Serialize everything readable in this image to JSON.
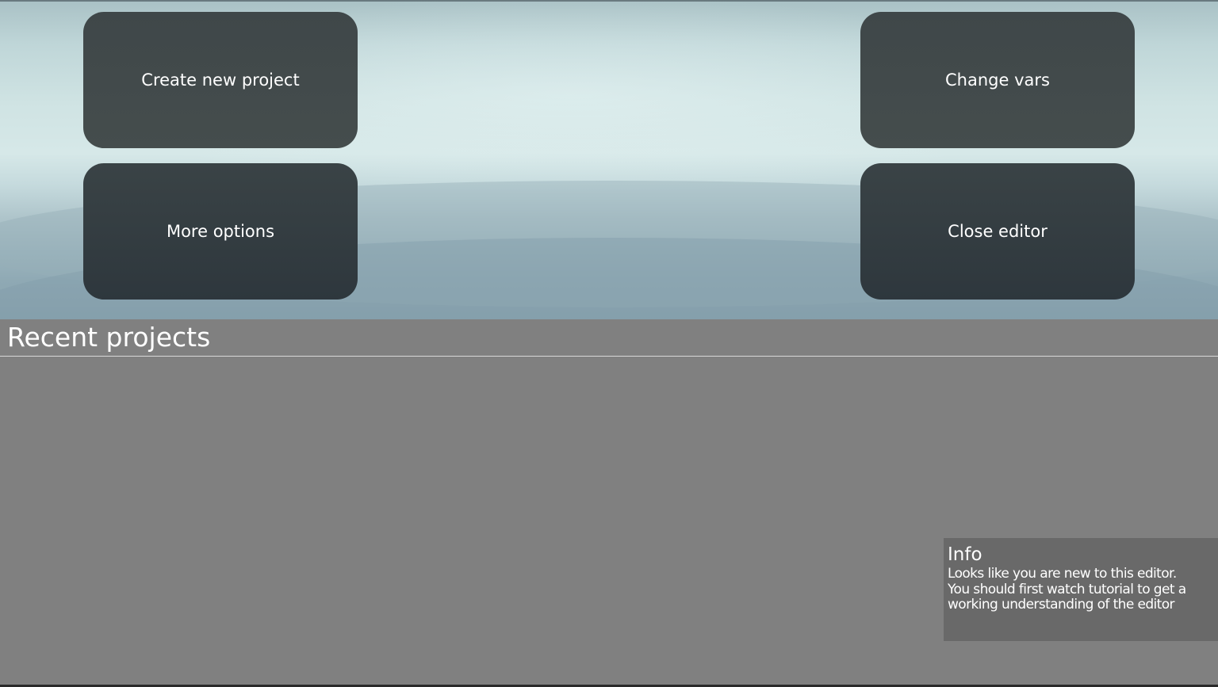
{
  "window": {
    "background_color": "#808080"
  },
  "actions": {
    "create_new_project": "Create new project",
    "change_vars": "Change vars",
    "more_options": "More options",
    "close_editor": "Close editor"
  },
  "recent": {
    "title": "Recent projects",
    "items": []
  },
  "info": {
    "title": "Info",
    "lines": [
      "Looks like you are new to this editor.",
      "You should first watch tutorial to get a",
      "working understanding of the editor"
    ]
  }
}
